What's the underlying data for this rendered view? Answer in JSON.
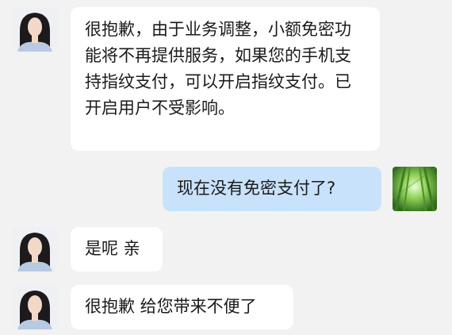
{
  "conversation": {
    "messages": [
      {
        "side": "incoming",
        "avatar": "agent-avatar",
        "text": "很抱歉，由于业务调整，小额免密功能将不再提供服务，如果您的手机支持指纹支付，可以开启指纹支付。已开启用户不受影响。"
      },
      {
        "side": "outgoing",
        "avatar": "user-avatar",
        "text": "现在没有免密支付了?"
      },
      {
        "side": "incoming",
        "avatar": "agent-avatar",
        "text": "是呢 亲"
      },
      {
        "side": "incoming",
        "avatar": "agent-avatar",
        "text": "很抱歉 给您带来不便了"
      }
    ]
  },
  "colors": {
    "background": "#f2f2f2",
    "incoming_bubble": "#ffffff",
    "outgoing_bubble": "#c9e2fb",
    "text": "#1a1a1a"
  }
}
